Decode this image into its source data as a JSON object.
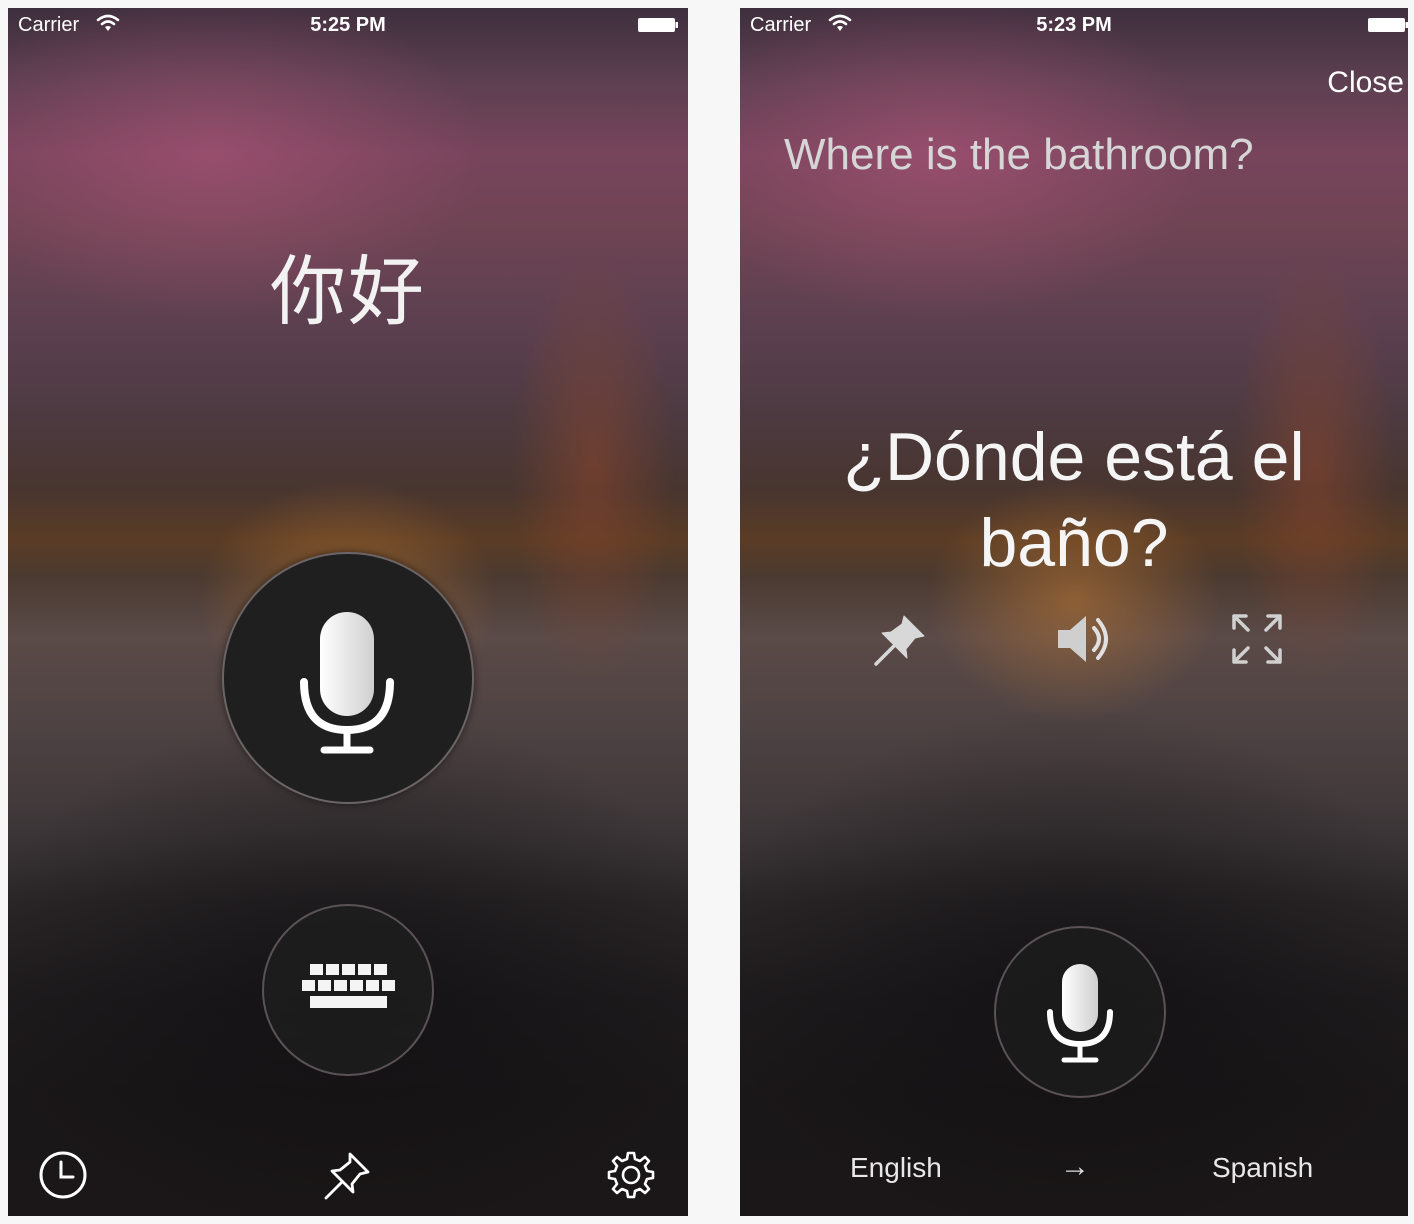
{
  "left_screen": {
    "status_bar": {
      "carrier": "Carrier",
      "time": "5:25 PM"
    },
    "phrase": "你好",
    "icons": {
      "mic": "microphone-icon",
      "keyboard": "keyboard-icon",
      "history": "clock-icon",
      "pin": "pin-icon",
      "settings": "gear-icon"
    }
  },
  "right_screen": {
    "status_bar": {
      "carrier": "Carrier",
      "time": "5:23 PM"
    },
    "close_label": "Close",
    "source_text": "Where is the bathroom?",
    "translation_text": "¿Dónde está el baño?",
    "actions": [
      "pin-icon",
      "speaker-icon",
      "fullscreen-icon"
    ],
    "languages": {
      "from": "English",
      "arrow": "→",
      "to": "Spanish"
    }
  },
  "colors": {
    "background": "#f7f7f7",
    "button_dark": "#1f1f1f",
    "text": "#ffffff"
  }
}
